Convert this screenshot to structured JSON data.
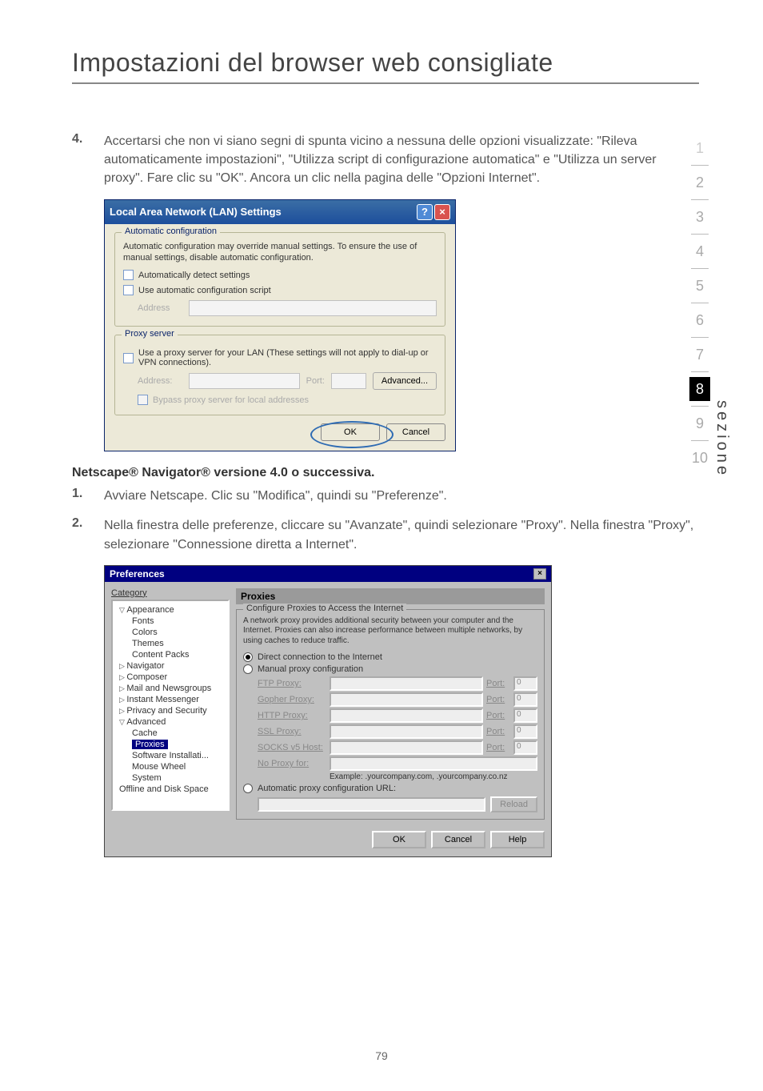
{
  "title": "Impostazioni del browser web consigliate",
  "step4_num": "4.",
  "step4_body": "Accertarsi che non vi siano segni di spunta vicino a nessuna delle opzioni visualizzate: \"Rileva automaticamente impostazioni\", \"Utilizza script di configurazione automatica\" e \"Utilizza un server proxy\". Fare clic su \"OK\". Ancora un clic nella pagina delle \"Opzioni Internet\".",
  "lan": {
    "title": "Local Area Network (LAN) Settings",
    "help": "?",
    "close": "×",
    "auto_group": "Automatic configuration",
    "auto_desc": "Automatic configuration may override manual settings.  To ensure the use of manual settings, disable automatic configuration.",
    "auto_detect": "Automatically detect settings",
    "auto_script": "Use automatic configuration script",
    "address": "Address",
    "proxy_group": "Proxy server",
    "proxy_desc": "Use a proxy server for your LAN (These settings will not apply to dial-up or VPN connections).",
    "addr_label": "Address:",
    "port_label": "Port:",
    "advanced": "Advanced...",
    "bypass": "Bypass proxy server for local addresses",
    "ok": "OK",
    "cancel": "Cancel"
  },
  "netscape_head": "Netscape® Navigator® versione 4.0 o successiva.",
  "ns1_num": "1.",
  "ns1_body": "Avviare Netscape. Clic su \"Modifica\", quindi su \"Preferenze\".",
  "ns2_num": "2.",
  "ns2_body": "Nella finestra delle preferenze, cliccare su \"Avanzate\", quindi selezionare \"Proxy\". Nella finestra \"Proxy\", selezionare \"Connessione diretta a Internet\".",
  "pref": {
    "title": "Preferences",
    "close": "×",
    "category": "Category",
    "tree": {
      "appearance": "Appearance",
      "fonts": "Fonts",
      "colors": "Colors",
      "themes": "Themes",
      "content": "Content Packs",
      "navigator": "Navigator",
      "composer": "Composer",
      "mail": "Mail and Newsgroups",
      "im": "Instant Messenger",
      "privacy": "Privacy and Security",
      "advanced": "Advanced",
      "cache": "Cache",
      "proxies": "Proxies",
      "software": "Software Installati...",
      "mouse": "Mouse Wheel",
      "system": "System",
      "offline": "Offline and Disk Space"
    },
    "panel_head": "Proxies",
    "group_title": "Configure Proxies to Access the Internet",
    "desc": "A network proxy provides additional security between your computer and the Internet. Proxies can also increase performance between multiple networks, by using caches to reduce traffic.",
    "direct": "Direct connection to the Internet",
    "manual": "Manual proxy configuration",
    "ftp": "FTP Proxy:",
    "gopher": "Gopher Proxy:",
    "http": "HTTP Proxy:",
    "ssl": "SSL Proxy:",
    "socks": "SOCKS v5 Host:",
    "noproxy": "No Proxy for:",
    "port": "Port:",
    "port_val": "0",
    "example": "Example: .yourcompany.com, .yourcompany.co.nz",
    "auto": "Automatic proxy configuration URL:",
    "reload": "Reload",
    "ok": "OK",
    "cancel": "Cancel",
    "help": "Help"
  },
  "tabs": [
    "1",
    "2",
    "3",
    "4",
    "5",
    "6",
    "7",
    "8",
    "9",
    "10"
  ],
  "side_label": "sezione",
  "page_num": "79"
}
